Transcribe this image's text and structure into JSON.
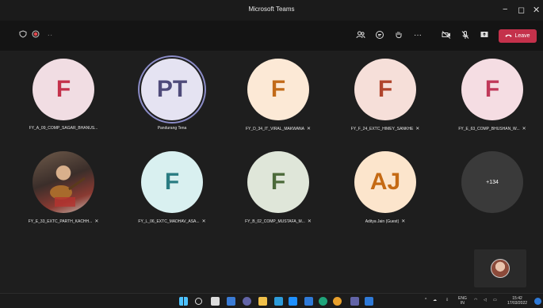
{
  "window": {
    "title": "Microsoft Teams"
  },
  "toolbar": {
    "leave_label": "Leave"
  },
  "participants": [
    {
      "initials": "F",
      "name": "FY_A_09_COMP_SAGAR_BHANUS...",
      "muted": false,
      "bg": "#f1dde3",
      "fg": "#c4314b"
    },
    {
      "initials": "PT",
      "name": "Pandurang Tena",
      "muted": false,
      "bg": "#e5e3f2",
      "fg": "#4f4b7a"
    },
    {
      "initials": "F",
      "name": "FY_D_34_IT_VIRAL_MAKWANA",
      "muted": true,
      "bg": "#fce9d6",
      "fg": "#c26a18"
    },
    {
      "initials": "F",
      "name": "FY_F_24_EXTC_HIMEY_SANKHE",
      "muted": true,
      "bg": "#f6dfd9",
      "fg": "#b0442c"
    },
    {
      "initials": "F",
      "name": "FY_E_63_COMP_BHUSHAN_W...",
      "muted": true,
      "bg": "#f5dde3",
      "fg": "#c0395a"
    },
    {
      "initials": "",
      "name": "FY_E_33_EXTC_PARTH_KACHH...",
      "muted": true,
      "bg": "#3b2e2a",
      "fg": "#ffffff",
      "photo": true
    },
    {
      "initials": "F",
      "name": "FY_L_06_EXTC_MADHAV_ASA...",
      "muted": true,
      "bg": "#d9f0f0",
      "fg": "#2a7c82"
    },
    {
      "initials": "F",
      "name": "FY_B_02_COMP_MUSTAFA_M...",
      "muted": true,
      "bg": "#dfe6d9",
      "fg": "#4c6a3a"
    },
    {
      "initials": "AJ",
      "name": "Aditya Jain (Guest)",
      "muted": true,
      "bg": "#fce5cc",
      "fg": "#c56a14"
    }
  ],
  "overflow": {
    "label": "+134"
  },
  "taskbar": {
    "lang_line1": "ENG",
    "lang_line2": "IN",
    "time": "15:42",
    "date": "17/03/2022"
  },
  "colors": {
    "leave": "#c4314b",
    "active_speaker_ring": "#8b8cc7"
  }
}
